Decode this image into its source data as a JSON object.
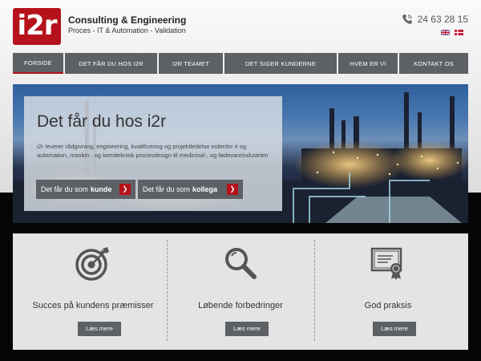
{
  "header": {
    "logo_text": "i2r",
    "company": "Consulting & Engineering",
    "tagline": "Proces - IT & Automation - Validation",
    "phone": "24 63 28 15",
    "languages": [
      "english-flag",
      "danish-flag"
    ]
  },
  "nav": {
    "items": [
      {
        "label": "FORSIDE",
        "active": true
      },
      {
        "label": "DET FÅR DU HOS I2R"
      },
      {
        "label": "I2R TEAMET"
      },
      {
        "label": "DET SIGER KUNDERNE"
      },
      {
        "label": "HVEM ER VI"
      },
      {
        "label": "KONTAKT OS"
      }
    ]
  },
  "hero": {
    "title": "Det får du hos i2r",
    "text": "i2r leverer rådgivning, engineering, kvalificering og projektledelse indenfor it og automation, maskin-, og kemiteknisk procesdesign til medicinal-, og fødevareindustrien",
    "buttons": [
      {
        "prefix": "Det får du som",
        "bold": "kunde"
      },
      {
        "prefix": "Det får du som",
        "bold": "kollega"
      }
    ]
  },
  "cards": [
    {
      "title": "Succes på kundens præmisser",
      "button": "Læs mere",
      "icon": "target-icon"
    },
    {
      "title": "Løbende forbedringer",
      "button": "Læs mere",
      "icon": "magnifier-icon"
    },
    {
      "title": "God praksis",
      "button": "Læs mere",
      "icon": "certificate-icon"
    }
  ],
  "colors": {
    "brand": "#b5121b",
    "nav": "#5d6166"
  }
}
